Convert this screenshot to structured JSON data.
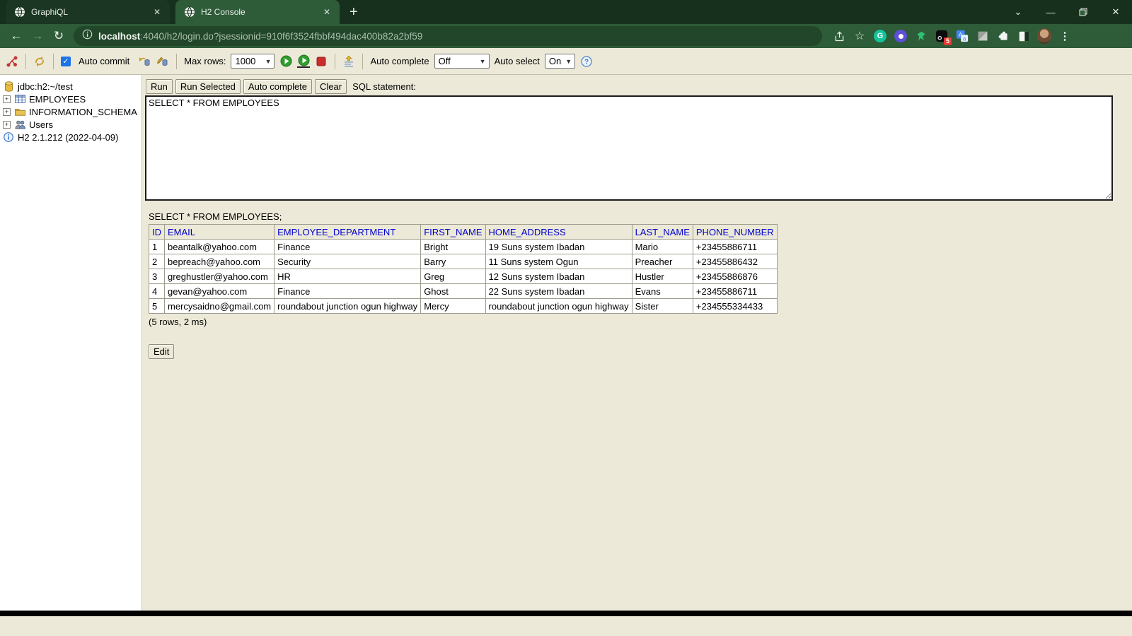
{
  "browser": {
    "tabs": [
      {
        "title": "GraphiQL"
      },
      {
        "title": "H2 Console"
      }
    ],
    "url": {
      "host": "localhost",
      "rest": ":4040/h2/login.do?jsessionid=910f6f3524fbbf494dac400b82a2bf59"
    },
    "extension_badge": "5",
    "grammarly_letter": "G"
  },
  "h2_toolbar": {
    "auto_commit_label": "Auto commit",
    "max_rows_label": "Max rows:",
    "max_rows_value": "1000",
    "auto_complete_label": "Auto complete",
    "auto_complete_value": "Off",
    "auto_select_label": "Auto select",
    "auto_select_value": "On"
  },
  "sidebar": {
    "items": [
      {
        "label": "jdbc:h2:~/test",
        "icon": "database"
      },
      {
        "label": "EMPLOYEES",
        "icon": "table"
      },
      {
        "label": "INFORMATION_SCHEMA",
        "icon": "folder"
      },
      {
        "label": "Users",
        "icon": "users"
      },
      {
        "label": "H2 2.1.212 (2022-04-09)",
        "icon": "info"
      }
    ]
  },
  "query": {
    "buttons": [
      "Run",
      "Run Selected",
      "Auto complete",
      "Clear"
    ],
    "sql_label": "SQL statement:",
    "sql_text": "SELECT * FROM EMPLOYEES"
  },
  "results": {
    "echo": "SELECT * FROM EMPLOYEES;",
    "columns": [
      "ID",
      "EMAIL",
      "EMPLOYEE_DEPARTMENT",
      "FIRST_NAME",
      "HOME_ADDRESS",
      "LAST_NAME",
      "PHONE_NUMBER"
    ],
    "rows": [
      [
        "1",
        "beantalk@yahoo.com",
        "Finance",
        "Bright",
        "19 Suns system Ibadan",
        "Mario",
        "+23455886711"
      ],
      [
        "2",
        "bepreach@yahoo.com",
        "Security",
        "Barry",
        "11 Suns system Ogun",
        "Preacher",
        "+23455886432"
      ],
      [
        "3",
        "greghustler@yahoo.com",
        "HR",
        "Greg",
        "12 Suns system Ibadan",
        "Hustler",
        "+23455886876"
      ],
      [
        "4",
        "gevan@yahoo.com",
        "Finance",
        "Ghost",
        "22 Suns system Ibadan",
        "Evans",
        "+23455886711"
      ],
      [
        "5",
        "mercysaidno@gmail.com",
        "roundabout junction ogun highway",
        "Mercy",
        "roundabout junction ogun highway",
        "Sister",
        "+234555334433"
      ]
    ],
    "status": "(5 rows, 2 ms)",
    "edit_label": "Edit"
  },
  "colors": {
    "tabstrip_green": "#17301d",
    "chrome_green": "#2e5b38",
    "urlpill_green": "#224629",
    "h2_beige": "#ece9d8",
    "header_blue": "#0000cc",
    "run_green": "#2f9e2f",
    "stop_red": "#cc2b2b"
  }
}
